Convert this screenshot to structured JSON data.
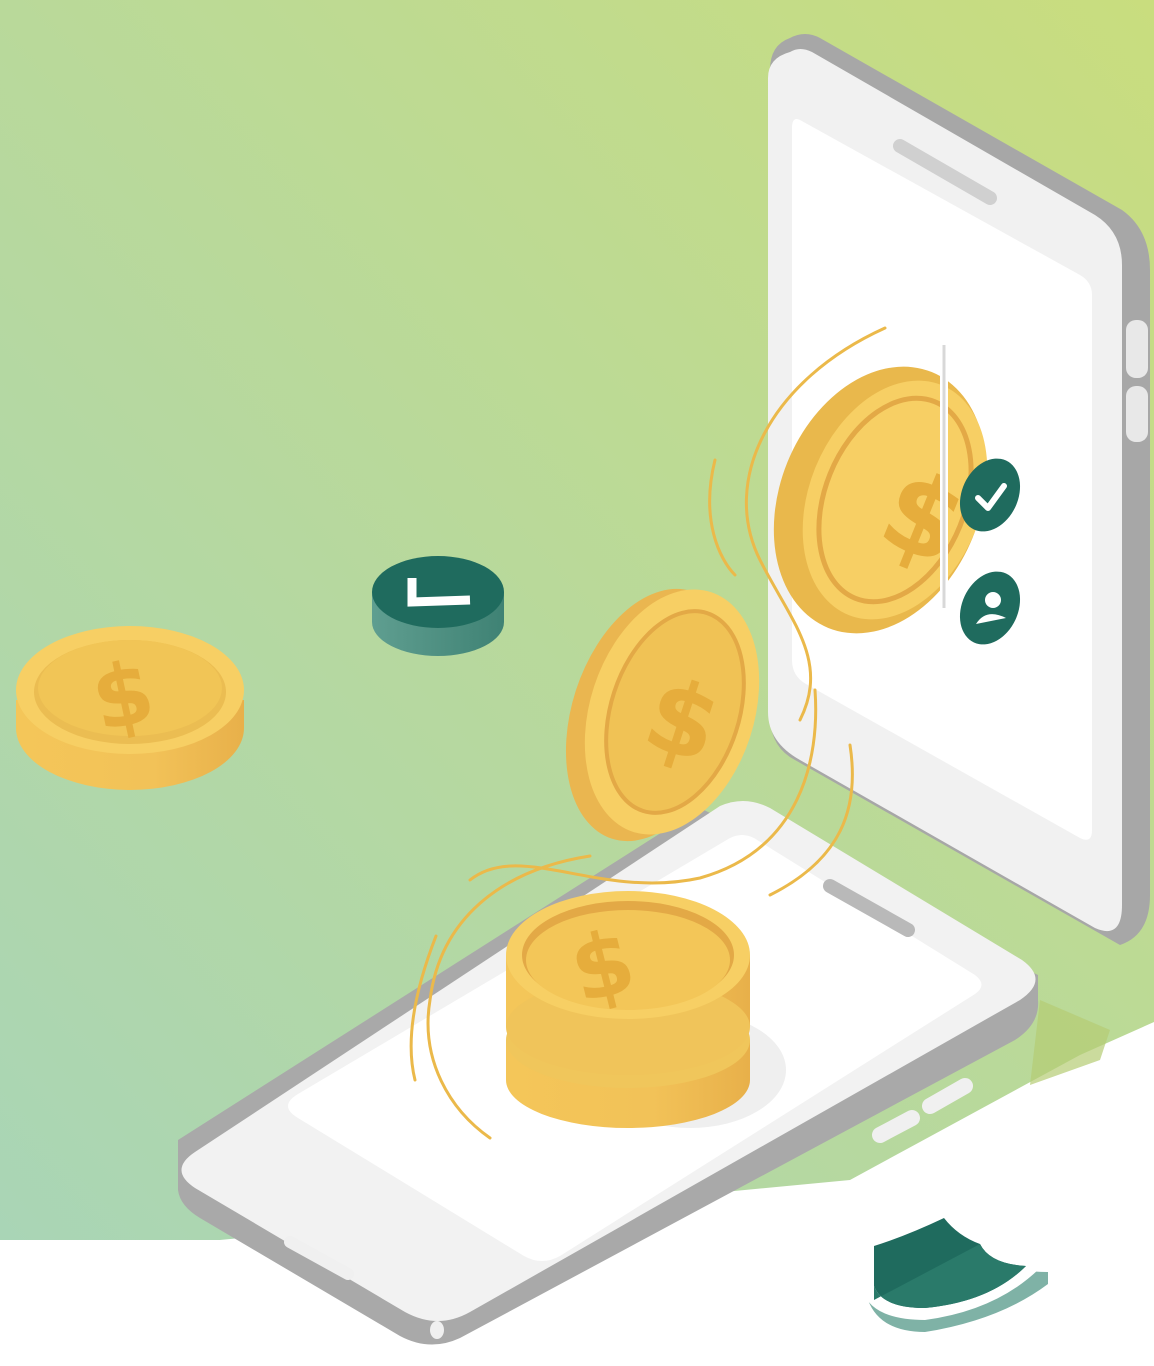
{
  "scene": {
    "description_free": true,
    "colors": {
      "bg_top_right": "#c8dc80",
      "bg_bottom_left": "#acd6b4",
      "phone_body": "#f4f4f4",
      "phone_edge": "#a9a9a9",
      "phone_screen": "#ffffff",
      "coin_face": "#f7cf64",
      "coin_rim": "#e9b84c",
      "coin_edge": "#f0c45a",
      "coin_symbol": "#e6ad3c",
      "badge_green": "#1f6b5e",
      "badge_green_light": "#5e9c8f",
      "motion_line": "#ebb94a"
    },
    "symbols": {
      "coin_symbol": "$"
    },
    "icons": [
      "dollar-coin-icon",
      "check-badge-icon",
      "user-badge-icon",
      "shield-icon",
      "token-chip-icon"
    ]
  }
}
